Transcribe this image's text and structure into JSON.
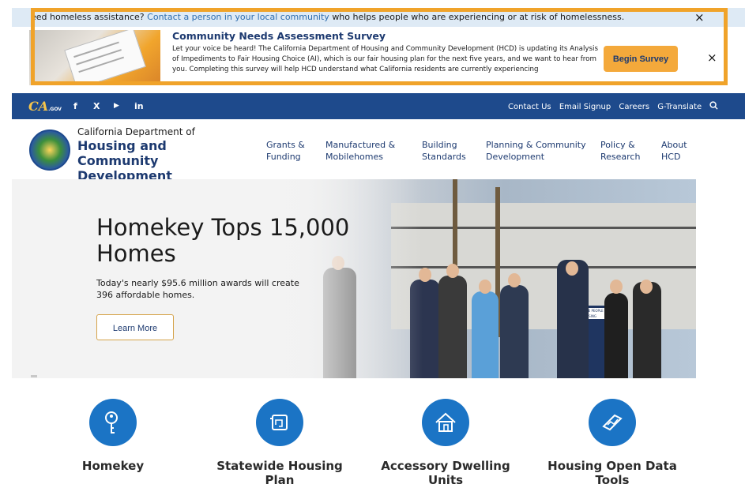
{
  "alert": {
    "prefix": "eed homeless assistance?",
    "link": "Contact a person in your local community",
    "suffix": "who helps people who are experiencing or at risk of homelessness.",
    "close": "×"
  },
  "survey": {
    "title": "Community Needs Assessment Survey",
    "body": "Let your voice be heard! The California Department of Housing and Community Development (HCD) is updating its Analysis of Impediments to Fair Housing Choice (AI), which is our fair housing plan for the next five years, and we want to hear from you. Completing this survey will help HCD understand what California residents are currently experiencing",
    "button": "Begin Survey",
    "close": "×"
  },
  "utility": {
    "logo": "CA",
    "logo_sub": ".GOV",
    "social": {
      "facebook": "f",
      "x": "X",
      "youtube": "▶",
      "linkedin": "in"
    },
    "links": [
      "Contact Us",
      "Email Signup",
      "Careers",
      "G-Translate"
    ],
    "search_icon": "search-icon"
  },
  "header": {
    "dept_small": "California Department of",
    "dept_big": "Housing and Community Development",
    "nav": [
      "Grants & Funding",
      "Manufactured & Mobilehomes",
      "Building Standards",
      "Planning & Community Development",
      "Policy & Research",
      "About HCD"
    ]
  },
  "hero": {
    "title": "Homekey Tops 15,000 Homes",
    "subtitle": "Today's nearly $95.6 million awards will create 396 affordable homes.",
    "button": "Learn More",
    "sign": "GETTING MORE PEOPLE INTO HOUSING"
  },
  "tiles": [
    {
      "label": "Homekey",
      "icon": "key-icon"
    },
    {
      "label": "Statewide Housing Plan",
      "icon": "blueprint-icon"
    },
    {
      "label": "Accessory Dwelling Units",
      "icon": "house-icon"
    },
    {
      "label": "Housing Open Data Tools",
      "icon": "map-chart-icon"
    }
  ],
  "colors": {
    "accent": "#f4a93b",
    "brand_blue": "#1e4a8c",
    "tile_blue": "#1b74c5"
  }
}
